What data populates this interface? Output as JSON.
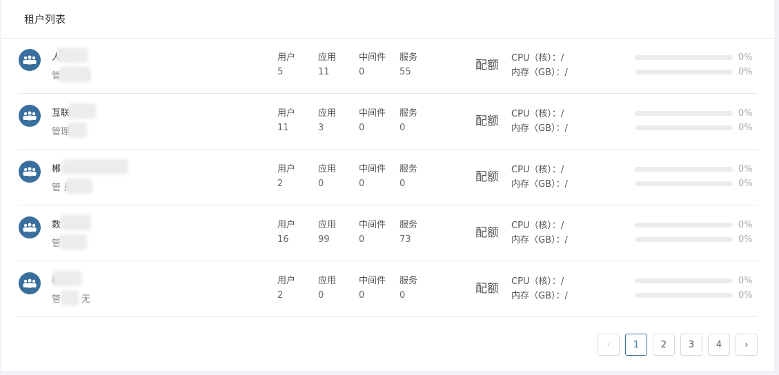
{
  "panel": {
    "title": "租户列表"
  },
  "labels": {
    "users": "用户",
    "apps": "应用",
    "middleware": "中间件",
    "services": "服务",
    "quota": "配额",
    "cpu": "CPU（核）：/",
    "memory": "内存（GB）：/"
  },
  "tenants": [
    {
      "name": "人 部",
      "admin": "管 蒋海杰",
      "users": "5",
      "apps": "11",
      "middleware": "0",
      "services": "55",
      "cpu_usage": "0%",
      "mem_usage": "0%",
      "cpu_fraction": 0,
      "mem_fraction": 0
    },
    {
      "name": "互联 服务",
      "admin": "管理 无",
      "users": "11",
      "apps": "3",
      "middleware": "0",
      "services": "0",
      "cpu_usage": "0%",
      "mem_usage": "0%",
      "cpu_fraction": 0,
      "mem_fraction": 0
    },
    {
      "name": "郴 数 ",
      "admin": "管 员 无",
      "users": "2",
      "apps": "0",
      "middleware": "0",
      "services": "0",
      "cpu_usage": "0%",
      "mem_usage": "0%",
      "cpu_fraction": 0,
      "mem_fraction": 0
    },
    {
      "name": "数 部",
      "admin": "管 ，无",
      "users": "16",
      "apps": "99",
      "middleware": "0",
      "services": "73",
      "cpu_usage": "0%",
      "mem_usage": "0%",
      "cpu_fraction": 0,
      "mem_fraction": 0
    },
    {
      "name": " 租户",
      "admin": "管 员：无",
      "users": "2",
      "apps": "0",
      "middleware": "0",
      "services": "0",
      "cpu_usage": "0%",
      "mem_usage": "0%",
      "cpu_fraction": 0,
      "mem_fraction": 0
    }
  ],
  "pagination": {
    "prev": "‹",
    "next": "›",
    "pages": [
      "1",
      "2",
      "3",
      "4"
    ],
    "current": "1"
  },
  "colors": {
    "accent": "#3a6f9d",
    "border": "#e8e8e8",
    "bar_track": "#ececec"
  },
  "icons": {
    "avatar": "group-users-icon",
    "prev": "chevron-left-icon",
    "next": "chevron-right-icon"
  }
}
